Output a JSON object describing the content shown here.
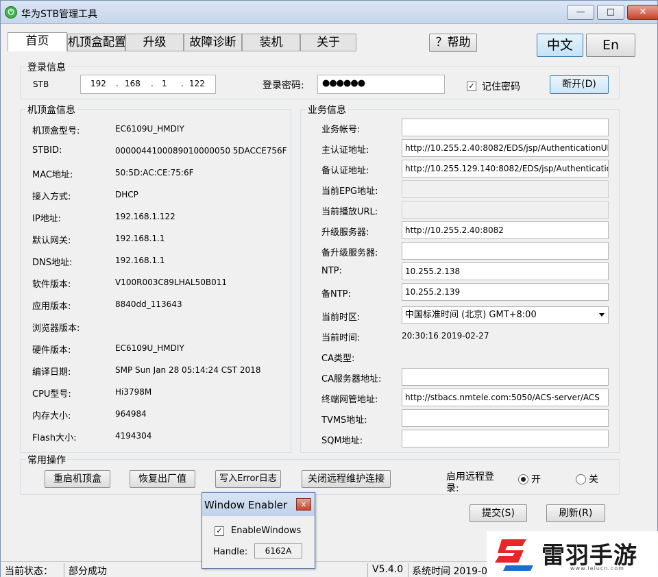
{
  "window": {
    "title": "华为STB管理工具",
    "min": "—",
    "max": "□",
    "close": "✕"
  },
  "tabs": [
    "首页",
    "机顶盒配置",
    "升级",
    "故障诊断",
    "装机",
    "关于"
  ],
  "help_button": "？帮助",
  "lang_buttons": {
    "zh": "中文",
    "en": "En"
  },
  "login": {
    "group_label": "登录信息",
    "stb_label": "STB",
    "ip": [
      "192",
      "168",
      "1",
      "122"
    ],
    "password_label": "登录密码:",
    "password_value": "●●●●●●",
    "remember_label": "记住密码",
    "remember_checked": "✓",
    "disconnect_button": "断开(D)"
  },
  "stb_info": {
    "group_label": "机顶盒信息",
    "rows": [
      {
        "label": "机顶盒型号:",
        "value": "EC6109U_HMDIY"
      },
      {
        "label": "STBID:",
        "value": "0000044100089010000050 5DACCE756F"
      },
      {
        "label": "MAC地址:",
        "value": "50:5D:AC:CE:75:6F"
      },
      {
        "label": "接入方式:",
        "value": "DHCP"
      },
      {
        "label": "IP地址:",
        "value": "192.168.1.122"
      },
      {
        "label": "默认网关:",
        "value": "192.168.1.1"
      },
      {
        "label": "DNS地址:",
        "value": "192.168.1.1"
      },
      {
        "label": "软件版本:",
        "value": "V100R003C89LHAL50B011"
      },
      {
        "label": "应用版本:",
        "value": "8840dd_113643"
      },
      {
        "label": "浏览器版本:",
        "value": ""
      },
      {
        "label": "硬件版本:",
        "value": "EC6109U_HMDIY"
      },
      {
        "label": "编译日期:",
        "value": "SMP Sun Jan 28 05:14:24 CST 2018"
      },
      {
        "label": "CPU型号:",
        "value": "Hi3798M"
      },
      {
        "label": "内存大小:",
        "value": "964984"
      },
      {
        "label": "Flash大小:",
        "value": "4194304"
      }
    ]
  },
  "service_info": {
    "group_label": "业务信息",
    "rows": [
      {
        "label": "业务帐号:",
        "value": "",
        "kind": "field"
      },
      {
        "label": "主认证地址:",
        "value": "http://10.255.2.40:8082/EDS/jsp/AuthenticationURL",
        "kind": "field"
      },
      {
        "label": "备认证地址:",
        "value": "http://10.255.129.140:8082/EDS/jsp/Authentication",
        "kind": "field"
      },
      {
        "label": "当前EPG地址:",
        "value": "",
        "kind": "disabled"
      },
      {
        "label": "当前播放URL:",
        "value": "",
        "kind": "disabled"
      },
      {
        "label": "升级服务器:",
        "value": "http://10.255.2.40:8082",
        "kind": "field"
      },
      {
        "label": "备升级服务器:",
        "value": "",
        "kind": "field"
      },
      {
        "label": "NTP:",
        "value": "10.255.2.138",
        "kind": "field"
      },
      {
        "label": "备NTP:",
        "value": "10.255.2.139",
        "kind": "field"
      },
      {
        "label": "当前时区:",
        "value": "中国标准时间 (北京) GMT+8:00",
        "kind": "select"
      },
      {
        "label": "当前时间:",
        "value": "20:30:16 2019-02-27",
        "kind": "text"
      },
      {
        "label": "CA类型:",
        "value": "",
        "kind": "text"
      },
      {
        "label": "CA服务器地址:",
        "value": "",
        "kind": "field"
      },
      {
        "label": "终端网管地址:",
        "value": "http://stbacs.nmtele.com:5050/ACS-server/ACS",
        "kind": "field"
      },
      {
        "label": "TVMS地址:",
        "value": "",
        "kind": "field"
      },
      {
        "label": "SQM地址:",
        "value": "",
        "kind": "field"
      }
    ]
  },
  "common_ops": {
    "group_label": "常用操作",
    "buttons": [
      "重启机顶盒",
      "恢复出厂值",
      "写入Error日志",
      "关闭远程维护连接"
    ],
    "remote_label": "启用远程登录:",
    "radio_on": "开",
    "radio_off": "关"
  },
  "actions": {
    "submit": "提交(S)",
    "refresh": "刷新(R)"
  },
  "status": {
    "label": "当前状态：",
    "value": "部分成功",
    "version": "V5.4.0",
    "time_label": "系统时间 2019-0"
  },
  "window_enabler": {
    "title": "Window Enabler",
    "close": "x",
    "checkbox_label": "EnableWindows",
    "checked": "✓",
    "handle_label": "Handle:",
    "handle_value": "6162A"
  },
  "watermark": {
    "text": "雷羽手游网",
    "url": "www.leiucn.com"
  }
}
